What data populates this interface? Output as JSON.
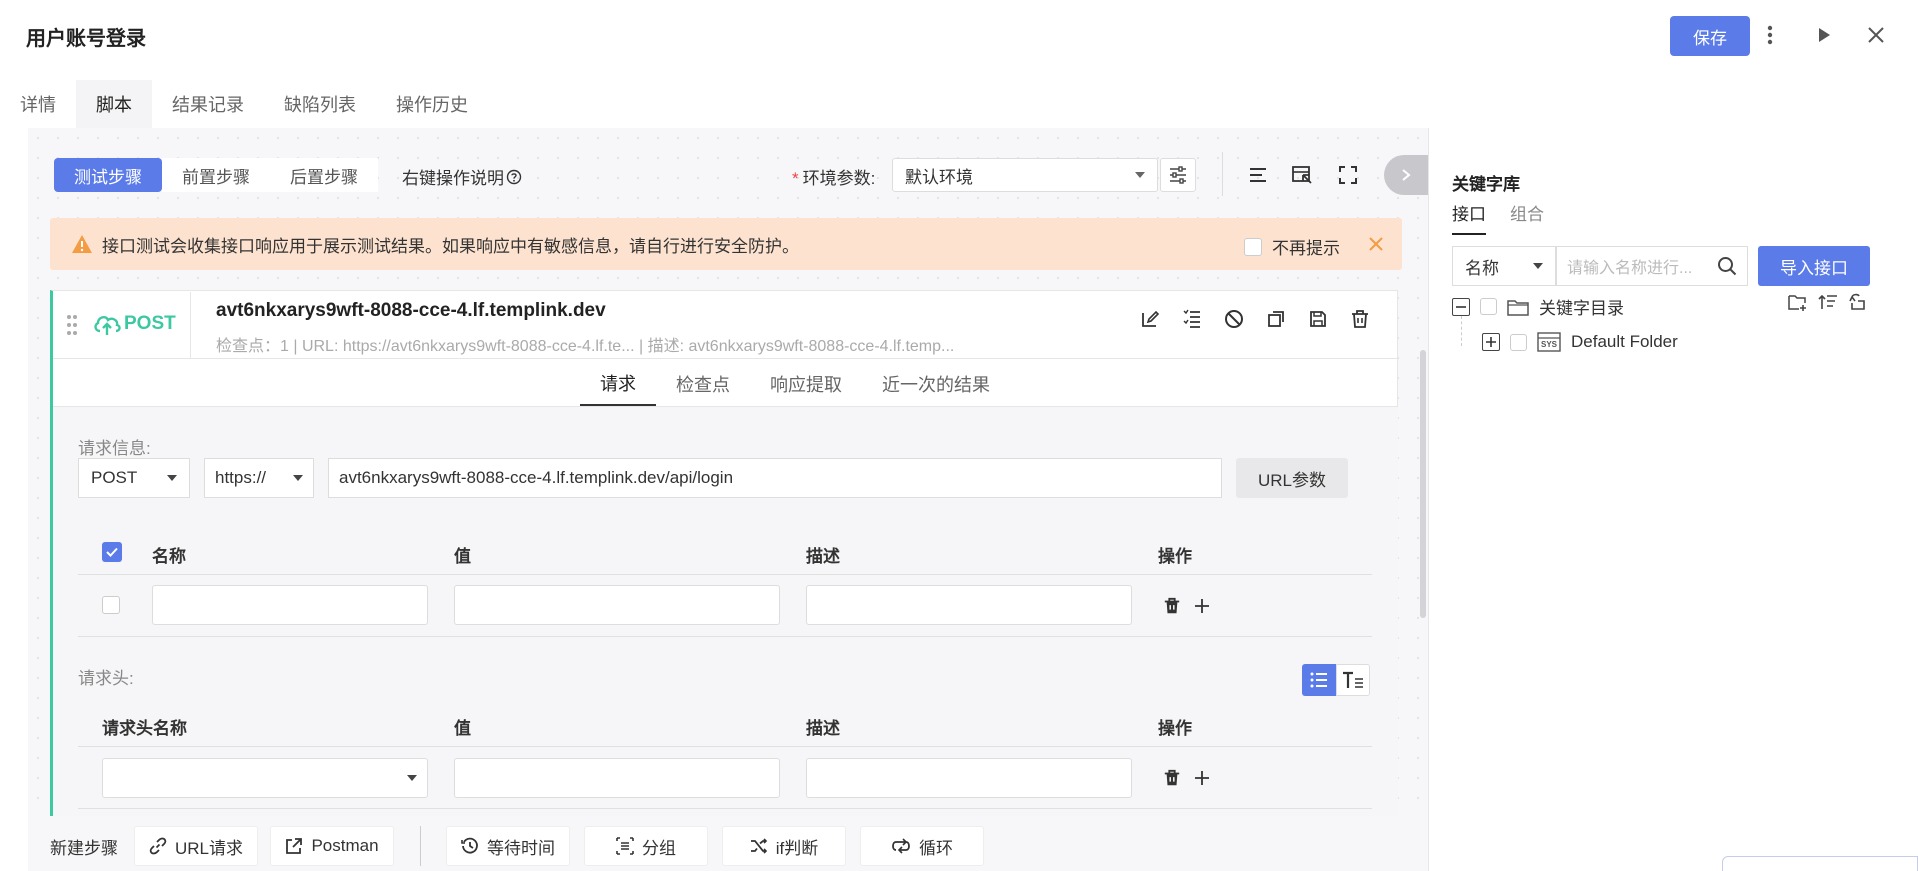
{
  "header": {
    "title": "用户账号登录",
    "save_label": "保存"
  },
  "main_tabs": [
    "详情",
    "脚本",
    "结果记录",
    "缺陷列表",
    "操作历史"
  ],
  "step_tabs": [
    "测试步骤",
    "前置步骤",
    "后置步骤"
  ],
  "right_click_help": "右键操作说明",
  "env": {
    "label": "环境参数:",
    "value": "默认环境"
  },
  "warning": {
    "text": "接口测试会收集接口响应用于展示测试结果。如果响应中有敏感信息，请自行进行安全防护。",
    "no_remind": "不再提示"
  },
  "api_card": {
    "method_badge": "POST",
    "title": "avt6nkxarys9wft-8088-cce-4.lf.templink.dev",
    "meta": "检查点：1  |  URL: https://avt6nkxarys9wft-8088-cce-4.lf.te...    |  描述: avt6nkxarys9wft-8088-cce-4.lf.temp...",
    "sub_tabs": [
      "请求",
      "检查点",
      "响应提取",
      "近一次的结果"
    ]
  },
  "request": {
    "info_label": "请求信息:",
    "method": "POST",
    "protocol": "https://",
    "url": "avt6nkxarys9wft-8088-cce-4.lf.templink.dev/api/login",
    "url_params_label": "URL参数",
    "params_headers": {
      "name": "名称",
      "value": "值",
      "desc": "描述",
      "ops": "操作"
    },
    "headers_label": "请求头:",
    "headers_headers": {
      "name": "请求头名称",
      "value": "值",
      "desc": "描述",
      "ops": "操作"
    }
  },
  "bottom_bar": {
    "label": "新建步骤",
    "buttons": [
      "URL请求",
      "Postman",
      "等待时间",
      "分组",
      "if判断",
      "循环"
    ]
  },
  "keyword_panel": {
    "title": "关键字库",
    "tabs": [
      "接口",
      "组合"
    ],
    "field_select": "名称",
    "search_placeholder": "请输入名称进行...",
    "import_label": "导入接口",
    "tree": {
      "root": "关键字目录",
      "child": "Default Folder",
      "child_badge": "SYS"
    }
  },
  "colors": {
    "primary": "#5b7be8",
    "accent_green": "#3cc8a0",
    "warning_bg": "#fde3cf",
    "warning_icon": "#f39c43"
  },
  "icons": [
    "more-vertical-icon",
    "play-icon",
    "close-icon",
    "question-circle-icon",
    "settings-sliders-icon",
    "align-icon",
    "select-icon",
    "fullscreen-icon",
    "chevron-right-icon",
    "warning-icon",
    "drag-handle-icon",
    "cloud-upload-icon",
    "edit-icon",
    "list-icon",
    "disable-icon",
    "copy-icon",
    "save-icon",
    "trash-icon",
    "plus-icon",
    "link-icon",
    "export-icon",
    "clock-icon",
    "group-icon",
    "shuffle-icon",
    "loop-icon",
    "search-icon",
    "folder-icon",
    "add-folder-icon",
    "sort-icon",
    "sync-icon"
  ]
}
